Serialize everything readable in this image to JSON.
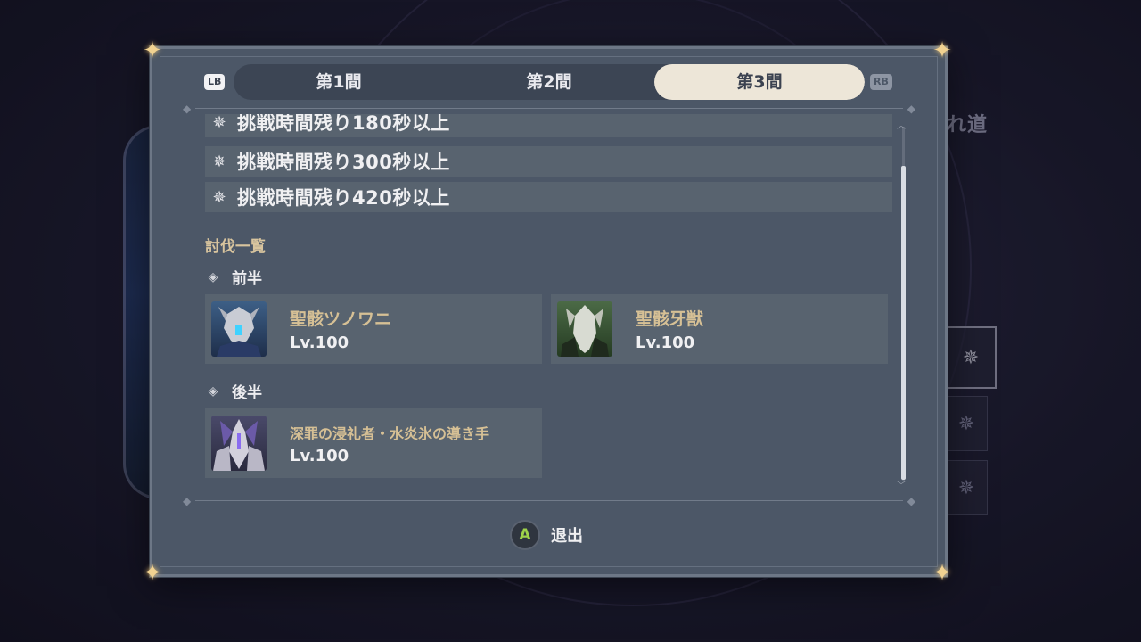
{
  "tabs": [
    {
      "label": "第1間",
      "active": false
    },
    {
      "label": "第2間",
      "active": false
    },
    {
      "label": "第3間",
      "active": true
    }
  ],
  "controller_hints": {
    "left": "LB",
    "right": "RB",
    "confirm": "A"
  },
  "background": {
    "side_title": "れ道"
  },
  "conditions": [
    {
      "icon": "star-icon",
      "text": "挑戦時間残り180秒以上"
    },
    {
      "icon": "star-icon",
      "text": "挑戦時間残り300秒以上"
    },
    {
      "icon": "star-icon",
      "text": "挑戦時間残り420秒以上"
    }
  ],
  "enemy_list": {
    "title": "討伐一覧",
    "first_half": {
      "label": "前半",
      "enemies": [
        {
          "name": "聖骸ツノワニ",
          "level": "Lv.100"
        },
        {
          "name": "聖骸牙獣",
          "level": "Lv.100"
        }
      ]
    },
    "second_half": {
      "label": "後半",
      "enemies": [
        {
          "name": "深罪の浸礼者・水炎氷の導き手",
          "level": "Lv.100"
        }
      ]
    }
  },
  "footer": {
    "exit_label": "退出"
  },
  "colors": {
    "panel_bg": "#4c5767",
    "row_bg": "#58636f",
    "active_tab": "#ede6d8",
    "gold_text": "#d6c095",
    "corner_gold": "#f1d291",
    "a_button_green": "#9fd34a"
  }
}
